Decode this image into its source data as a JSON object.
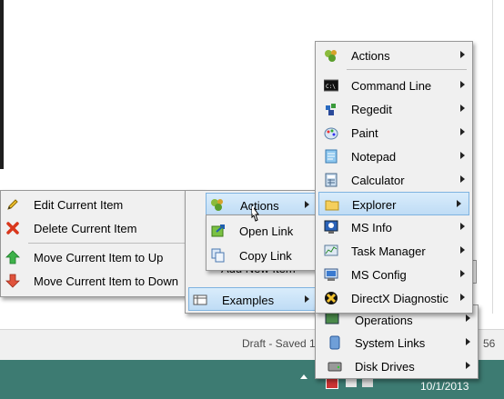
{
  "colors": {
    "taskbar": "#3d7b72",
    "statusbar": "#f0f0f0",
    "highlight": "#cfe5f8",
    "accent_blue": "#2b6fc0"
  },
  "left_menu": {
    "items": [
      {
        "label": "Edit Current Item",
        "icon": "pencil-icon"
      },
      {
        "label": "Delete Current Item",
        "icon": "delete-x-icon"
      },
      {
        "label": "Move Current Item to Up",
        "icon": "arrow-up-icon"
      },
      {
        "label": "Move Current Item to Down",
        "icon": "arrow-down-icon"
      }
    ]
  },
  "middle_menu": {
    "actions_label": "Actions",
    "add_new_item_label": "Add New Item",
    "examples_label": "Examples"
  },
  "actions_submenu": {
    "items": [
      {
        "label": "Open Link",
        "icon": "open-link-icon"
      },
      {
        "label": "Copy Link",
        "icon": "copy-link-icon"
      }
    ]
  },
  "right_menu": {
    "items": [
      {
        "label": "Actions",
        "icon": "actions-icon"
      },
      {
        "label": "Command Line",
        "icon": "command-line-icon"
      },
      {
        "label": "Regedit",
        "icon": "regedit-icon"
      },
      {
        "label": "Paint",
        "icon": "paint-icon"
      },
      {
        "label": "Notepad",
        "icon": "notepad-icon"
      },
      {
        "label": "Calculator",
        "icon": "calculator-icon"
      },
      {
        "label": "Explorer",
        "icon": "explorer-folder-icon"
      },
      {
        "label": "MS Info",
        "icon": "ms-info-icon"
      },
      {
        "label": "Task Manager",
        "icon": "task-manager-icon"
      },
      {
        "label": "MS Config",
        "icon": "ms-config-icon"
      },
      {
        "label": "DirectX Diagnostic",
        "icon": "directx-icon"
      }
    ]
  },
  "lower_menu": {
    "items": [
      {
        "label": "Operations",
        "icon": "operations-icon"
      },
      {
        "label": "System Links",
        "icon": "system-links-icon"
      },
      {
        "label": "Disk Drives",
        "icon": "disk-drives-icon"
      }
    ]
  },
  "status_bar": {
    "text": "Draft - Saved 1",
    "right_fragment": "56"
  },
  "taskbar": {
    "date": "10/1/2013"
  }
}
